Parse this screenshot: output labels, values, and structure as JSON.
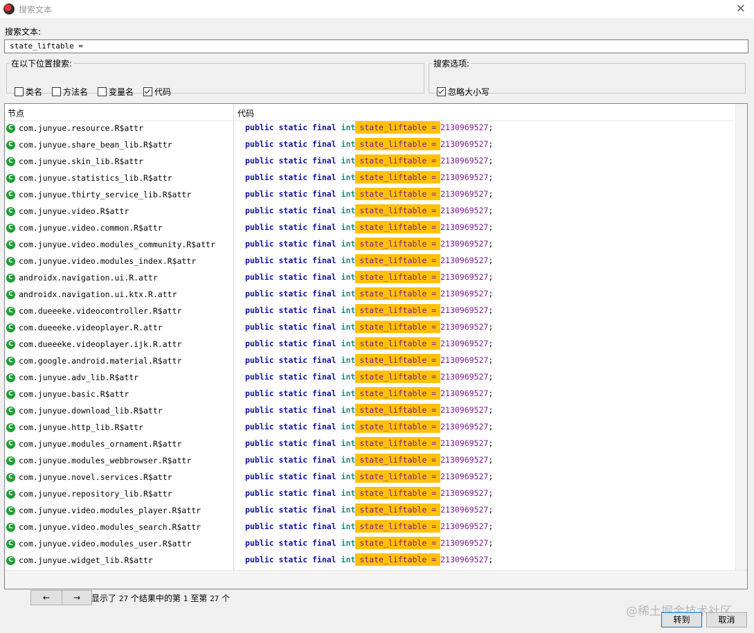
{
  "window": {
    "title": "搜索文本",
    "close_glyph": "✕"
  },
  "search": {
    "label": "搜索文本:",
    "value": "state_liftable ="
  },
  "location_group": {
    "legend": "在以下位置搜索:",
    "options": [
      {
        "label": "类名",
        "checked": false
      },
      {
        "label": "方法名",
        "checked": false
      },
      {
        "label": "变量名",
        "checked": false
      },
      {
        "label": "代码",
        "checked": true
      }
    ]
  },
  "options_group": {
    "legend": "搜索选项:",
    "options": [
      {
        "label": "忽略大小写",
        "checked": true
      }
    ]
  },
  "results": {
    "columns": {
      "node": "节点",
      "code": "代码"
    },
    "code_parts": {
      "kw1": "public",
      "kw2": "static",
      "kw3": "final",
      "type": "int",
      "highlight": "state_liftable =",
      "value": "2130969527",
      "semi": ";"
    },
    "rows": [
      "com.junyue.resource.R$attr",
      "com.junyue.share_bean_lib.R$attr",
      "com.junyue.skin_lib.R$attr",
      "com.junyue.statistics_lib.R$attr",
      "com.junyue.thirty_service_lib.R$attr",
      "com.junyue.video.R$attr",
      "com.junyue.video.common.R$attr",
      "com.junyue.video.modules_community.R$attr",
      "com.junyue.video.modules_index.R$attr",
      "androidx.navigation.ui.R.attr",
      "androidx.navigation.ui.ktx.R.attr",
      "com.dueeeke.videocontroller.R$attr",
      "com.dueeeke.videoplayer.R.attr",
      "com.dueeeke.videoplayer.ijk.R.attr",
      "com.google.android.material.R$attr",
      "com.junyue.adv_lib.R$attr",
      "com.junyue.basic.R$attr",
      "com.junyue.download_lib.R$attr",
      "com.junyue.http_lib.R$attr",
      "com.junyue.modules_ornament.R$attr",
      "com.junyue.modules_webbrowser.R$attr",
      "com.junyue.novel.services.R$attr",
      "com.junyue.repository_lib.R$attr",
      "com.junyue.video.modules_player.R$attr",
      "com.junyue.video.modules_search.R$attr",
      "com.junyue.video.modules_user.R$attr",
      "com.junyue.widget_lib.R$attr"
    ]
  },
  "pager": {
    "prev": "←",
    "next": "→",
    "status_a": "显示了",
    "shown": "27",
    "status_b": "个结果中的第",
    "from": "1",
    "status_c": "至第",
    "to": "27",
    "status_d": "个"
  },
  "buttons": {
    "go": "转到",
    "cancel": "取消"
  },
  "watermark": "@稀土掘金技术社区"
}
